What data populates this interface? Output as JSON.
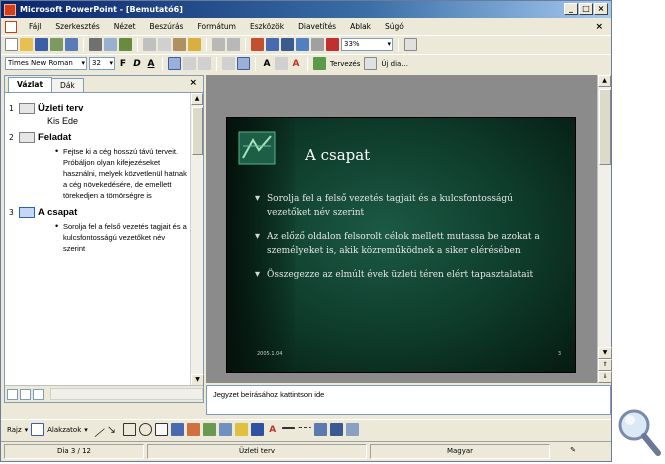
{
  "window": {
    "title": "Microsoft PowerPoint - [Bemutató6]"
  },
  "menu": [
    "Fájl",
    "Szerkesztés",
    "Nézet",
    "Beszúrás",
    "Formátum",
    "Eszközök",
    "Diavetítés",
    "Ablak",
    "Súgó"
  ],
  "toolbar": {
    "zoom": "33%"
  },
  "format_toolbar": {
    "font": "Times New Roman",
    "size": "32",
    "tervezes": "Tervezés",
    "uj_dia": "Új dia..."
  },
  "tabs": {
    "outline": "Vázlat",
    "slides": "Dák"
  },
  "outline": [
    {
      "num": "1",
      "title": "Üzleti terv",
      "sub": "Kis Ede"
    },
    {
      "num": "2",
      "title": "Feladat",
      "bullet": "Fejtse ki a cég hosszú távú terveit. Próbáljon olyan kifejezéseket használni, melyek közvetlenül hatnak a cég növekedésére, de emellett törekedjen a tömörségre is"
    },
    {
      "num": "3",
      "title": "A csapat",
      "bullet": "Sorolja fel a felső vezetés tagjait és a kulcsfontosságú vezetőket név szerint"
    }
  ],
  "slide": {
    "title": "A csapat",
    "bullets": [
      "Sorolja fel a felső vezetés tagjait és a kulcsfontosságú vezetőket név szerint",
      "Az előző oldalon felsorolt célok mellett mutassa be azokat a személyeket is, akik közreműködnek a siker elérésében",
      "Összegezze az elmúlt évek üzleti téren elért tapasztalatait"
    ],
    "date": "2005.1.04",
    "number": "3"
  },
  "notes": {
    "placeholder": "Jegyzet beírásához kattintson ide"
  },
  "drawbar": {
    "rajz": "Rajz",
    "alakzatok": "Alakzatok"
  },
  "status": {
    "slide": "Dia 3 / 12",
    "design": "Üzleti terv",
    "language": "Magyar"
  }
}
